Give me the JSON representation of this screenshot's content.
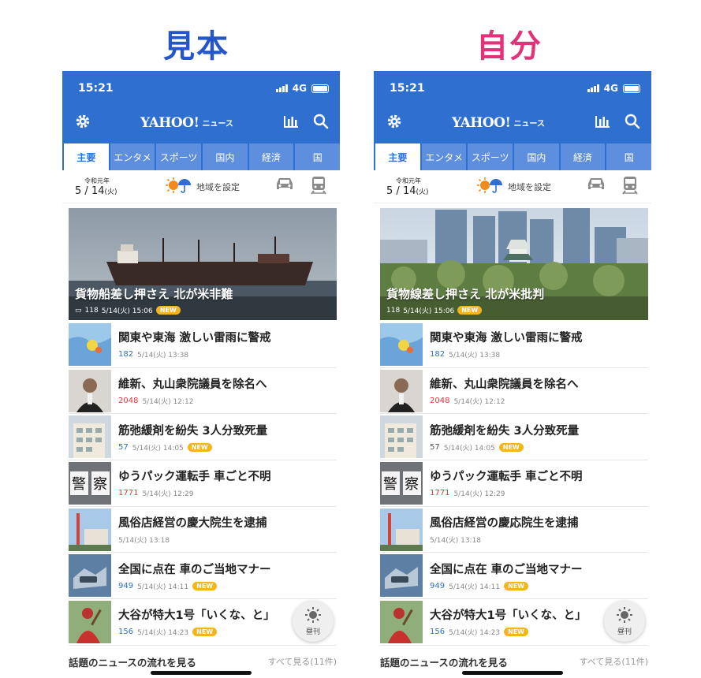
{
  "colors": {
    "left_heading": "#2456c8",
    "right_heading": "#e0337a",
    "brand_blue": "#2e6fd0",
    "badge": "#f2b51c"
  },
  "panels": [
    {
      "heading": "見本",
      "status": {
        "time": "15:21",
        "network": "4G"
      },
      "header": {
        "logo": "YAHOO!",
        "logo_sub": "JAPAN",
        "logo_news": "ニュース",
        "icons": [
          "gear-icon",
          "ranking-icon",
          "search-icon"
        ]
      },
      "tabs": [
        "主要",
        "エンタメ",
        "スポーツ",
        "国内",
        "経済",
        "国"
      ],
      "weather": {
        "era": "令和元年",
        "month": "5",
        "day": "14",
        "weekday": "(火)",
        "region_label": "地域を設定"
      },
      "hero": {
        "title": "貨物船差し押さえ 北が米非難",
        "comments": "118",
        "time": "5/14(火) 15:06",
        "badge": "NEW"
      },
      "articles": [
        {
          "title": "関東や東海 激しい雷雨に警戒",
          "comments": "182",
          "comment_color": "blue",
          "time": "5/14(火) 13:38",
          "badge": ""
        },
        {
          "title": "維新、丸山衆院議員を除名へ",
          "comments": "2048",
          "comment_color": "red",
          "time": "5/14(火) 12:12",
          "badge": ""
        },
        {
          "title": "筋弛緩剤を紛失 3人分致死量",
          "comments": "57",
          "comment_color": "blue",
          "time": "5/14(火) 14:05",
          "badge": "NEW"
        },
        {
          "title": "ゆうパック運転手 車ごと不明",
          "comments": "1771",
          "comment_color": "red",
          "time": "5/14(火) 12:29",
          "badge": ""
        },
        {
          "title": "風俗店経営の慶大院生を逮捕",
          "comments": "",
          "comment_color": "blue",
          "time": "5/14(火) 13:18",
          "badge": ""
        },
        {
          "title": "全国に点在 車のご当地マナー",
          "comments": "949",
          "comment_color": "blue",
          "time": "5/14(火) 14:11",
          "badge": "NEW"
        },
        {
          "title": "大谷が特大1号「いくな、と」",
          "comments": "156",
          "comment_color": "blue",
          "time": "5/14(火) 14:23",
          "badge": "NEW"
        }
      ],
      "fab_label": "昼刊",
      "footer": {
        "title": "話題のニュースの流れを見る",
        "link": "すべて見る(11件)"
      }
    },
    {
      "heading": "自分",
      "status": {
        "time": "15:21",
        "network": "4G"
      },
      "header": {
        "logo": "YAHOO!",
        "logo_sub": "JAPAN",
        "logo_news": "ニュース",
        "icons": [
          "gear-icon",
          "ranking-icon",
          "search-icon"
        ]
      },
      "tabs": [
        "主要",
        "エンタメ",
        "スポーツ",
        "国内",
        "経済",
        "国"
      ],
      "weather": {
        "era": "令和元年",
        "month": "5",
        "day": "14",
        "weekday": "(火)",
        "region_label": "地域を設定"
      },
      "hero": {
        "title": "貨物線差し押さえ 北が米批判",
        "comments": "118",
        "time": "5/14(火) 15:06",
        "badge": "NEW"
      },
      "articles": [
        {
          "title": "関東や東海 激しい雷雨に警戒",
          "comments": "182",
          "comment_color": "blue",
          "time": "5/14(火) 13:38",
          "badge": ""
        },
        {
          "title": "維新、丸山衆院議員を除名へ",
          "comments": "2048",
          "comment_color": "red",
          "time": "5/14(火) 12:12",
          "badge": ""
        },
        {
          "title": "筋弛緩剤を紛失 3人分致死量",
          "comments": "57",
          "comment_color": "gray",
          "time": "5/14(火) 14:05",
          "badge": "NEW"
        },
        {
          "title": "ゆうパック運転手 車ごと不明",
          "comments": "1771",
          "comment_color": "red",
          "time": "5/14(火) 12:29",
          "badge": ""
        },
        {
          "title": "風俗店経営の慶応院生を逮捕",
          "comments": "",
          "comment_color": "blue",
          "time": "5/14(火) 13:18",
          "badge": ""
        },
        {
          "title": "全国に点在 車のご当地マナー",
          "comments": "949",
          "comment_color": "blue",
          "time": "5/14(火) 14:11",
          "badge": "NEW"
        },
        {
          "title": "大谷が特大1号「いくな、と」",
          "comments": "156",
          "comment_color": "blue",
          "time": "5/14(火) 14:23",
          "badge": "NEW"
        }
      ],
      "fab_label": "昼刊",
      "footer": {
        "title": "話題のニュースの流れを見る",
        "link": "すべて見る(11件)"
      }
    }
  ]
}
